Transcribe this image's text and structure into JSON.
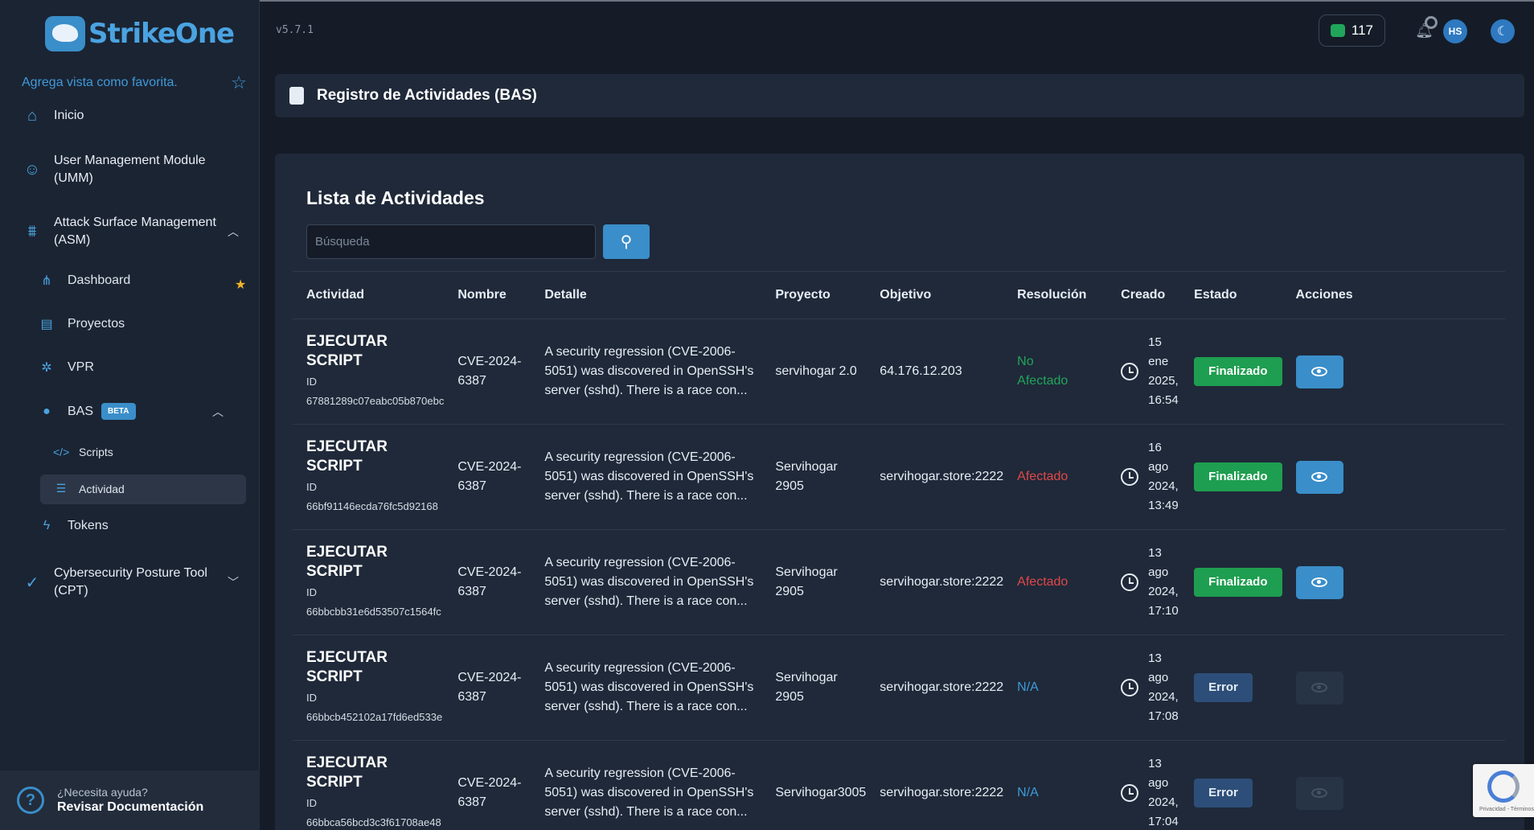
{
  "app": {
    "logo_text": "StrikeOne",
    "version": "v5.7.1"
  },
  "sidebar": {
    "favorite_text": "Agrega vista como favorita.",
    "items": [
      {
        "label": "Inicio"
      },
      {
        "label": "User Management Module (UMM)"
      },
      {
        "label": "Attack Surface Management (ASM)"
      },
      {
        "label": "Cybersecurity Posture Tool (CPT)"
      }
    ],
    "asm_sub": [
      {
        "label": "Dashboard"
      },
      {
        "label": "Proyectos"
      },
      {
        "label": "VPR"
      },
      {
        "label": "BAS",
        "badge": "BETA"
      },
      {
        "label": "Tokens"
      }
    ],
    "bas_sub": [
      {
        "label": "Scripts"
      },
      {
        "label": "Actividad"
      }
    ],
    "help": {
      "small": "¿Necesita ayuda?",
      "big": "Revisar Documentación"
    }
  },
  "topbar": {
    "credits": "117",
    "avatar": "HS"
  },
  "page": {
    "title": "Registro de Actividades (BAS)"
  },
  "list": {
    "title": "Lista de Actividades",
    "search_placeholder": "Búsqueda",
    "columns": [
      "Actividad",
      "Nombre",
      "Detalle",
      "Proyecto",
      "Objetivo",
      "Resolución",
      "Creado",
      "Estado",
      "Acciones"
    ],
    "rows": [
      {
        "activity": "EJECUTAR SCRIPT",
        "id": "ID 67881289c07eabc05b870ebc",
        "name": "CVE-2024-6387",
        "detail": "A security regression (CVE-2006-5051) was discovered in OpenSSH's server (sshd). There is a race con...",
        "project": "servihogar 2.0",
        "target": "64.176.12.203",
        "resolution": "No Afectado",
        "created": "15 ene 2025, 16:54",
        "status": "Finalizado"
      },
      {
        "activity": "EJECUTAR SCRIPT",
        "id": "ID 66bf91146ecda76fc5d92168",
        "name": "CVE-2024-6387",
        "detail": "A security regression (CVE-2006-5051) was discovered in OpenSSH's server (sshd). There is a race con...",
        "project": "Servihogar 2905",
        "target": "servihogar.store:2222",
        "resolution": "Afectado",
        "created": "16 ago 2024, 13:49",
        "status": "Finalizado"
      },
      {
        "activity": "EJECUTAR SCRIPT",
        "id": "ID 66bbcbb31e6d53507c1564fc",
        "name": "CVE-2024-6387",
        "detail": "A security regression (CVE-2006-5051) was discovered in OpenSSH's server (sshd). There is a race con...",
        "project": "Servihogar 2905",
        "target": "servihogar.store:2222",
        "resolution": "Afectado",
        "created": "13 ago 2024, 17:10",
        "status": "Finalizado"
      },
      {
        "activity": "EJECUTAR SCRIPT",
        "id": "ID 66bbcb452102a17fd6ed533e",
        "name": "CVE-2024-6387",
        "detail": "A security regression (CVE-2006-5051) was discovered in OpenSSH's server (sshd). There is a race con...",
        "project": "Servihogar 2905",
        "target": "servihogar.store:2222",
        "resolution": "N/A",
        "created": "13 ago 2024, 17:08",
        "status": "Error"
      },
      {
        "activity": "EJECUTAR SCRIPT",
        "id": "ID 66bbca56bcd3c3f61708ae48",
        "name": "CVE-2024-6387",
        "detail": "A security regression (CVE-2006-5051) was discovered in OpenSSH's server (sshd). There is a race con...",
        "project": "Servihogar3005",
        "target": "servihogar.store:2222",
        "resolution": "N/A",
        "created": "13 ago 2024, 17:04",
        "status": "Error"
      }
    ]
  },
  "recaptcha": {
    "text": "Privacidad - Términos"
  },
  "colors": {
    "accent": "#3a8ec9",
    "success": "#1e9e50",
    "danger": "#e04848",
    "background": "#151c28",
    "card": "#1f2939"
  }
}
